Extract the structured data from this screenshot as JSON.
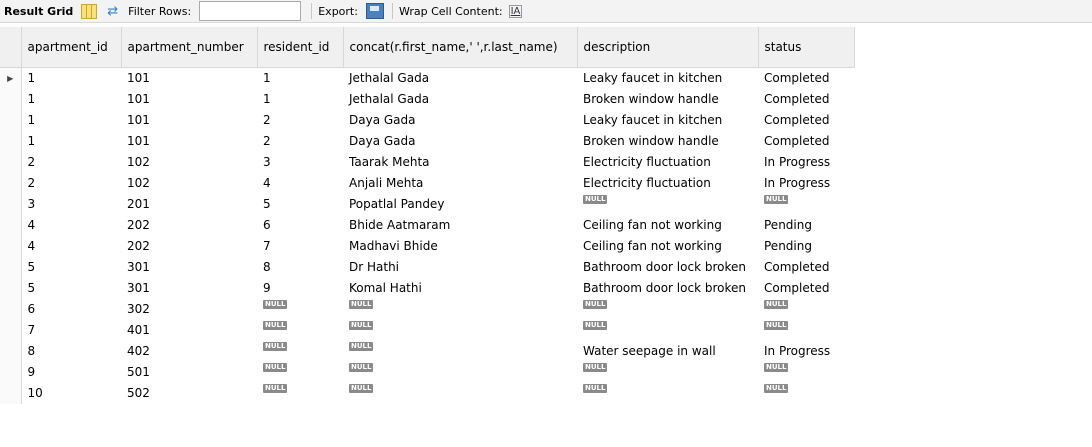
{
  "toolbar": {
    "result_grid_label": "Result Grid",
    "filter_rows_label": "Filter Rows:",
    "filter_rows_value": "",
    "export_label": "Export:",
    "wrap_label": "Wrap Cell Content:",
    "icons": [
      "grid-layout-icon",
      "refresh-filter-icon",
      "save-export-icon",
      "wrap-text-icon"
    ]
  },
  "null_label": "NULL",
  "columns": [
    "apartment_id",
    "apartment_number",
    "resident_id",
    "concat(r.first_name,' ',r.last_name)",
    "description",
    "status"
  ],
  "rows": [
    [
      "1",
      "101",
      "1",
      "Jethalal Gada",
      "Leaky faucet in kitchen",
      "Completed"
    ],
    [
      "1",
      "101",
      "1",
      "Jethalal Gada",
      "Broken window handle",
      "Completed"
    ],
    [
      "1",
      "101",
      "2",
      "Daya Gada",
      "Leaky faucet in kitchen",
      "Completed"
    ],
    [
      "1",
      "101",
      "2",
      "Daya Gada",
      "Broken window handle",
      "Completed"
    ],
    [
      "2",
      "102",
      "3",
      "Taarak Mehta",
      "Electricity fluctuation",
      "In Progress"
    ],
    [
      "2",
      "102",
      "4",
      "Anjali Mehta",
      "Electricity fluctuation",
      "In Progress"
    ],
    [
      "3",
      "201",
      "5",
      "Popatlal Pandey",
      null,
      null
    ],
    [
      "4",
      "202",
      "6",
      "Bhide Aatmaram",
      "Ceiling fan not working",
      "Pending"
    ],
    [
      "4",
      "202",
      "7",
      "Madhavi Bhide",
      "Ceiling fan not working",
      "Pending"
    ],
    [
      "5",
      "301",
      "8",
      "Dr Hathi",
      "Bathroom door lock broken",
      "Completed"
    ],
    [
      "5",
      "301",
      "9",
      "Komal Hathi",
      "Bathroom door lock broken",
      "Completed"
    ],
    [
      "6",
      "302",
      null,
      null,
      null,
      null
    ],
    [
      "7",
      "401",
      null,
      null,
      null,
      null
    ],
    [
      "8",
      "402",
      null,
      null,
      "Water seepage in wall",
      "In Progress"
    ],
    [
      "9",
      "501",
      null,
      null,
      null,
      null
    ],
    [
      "10",
      "502",
      null,
      null,
      null,
      null
    ]
  ]
}
